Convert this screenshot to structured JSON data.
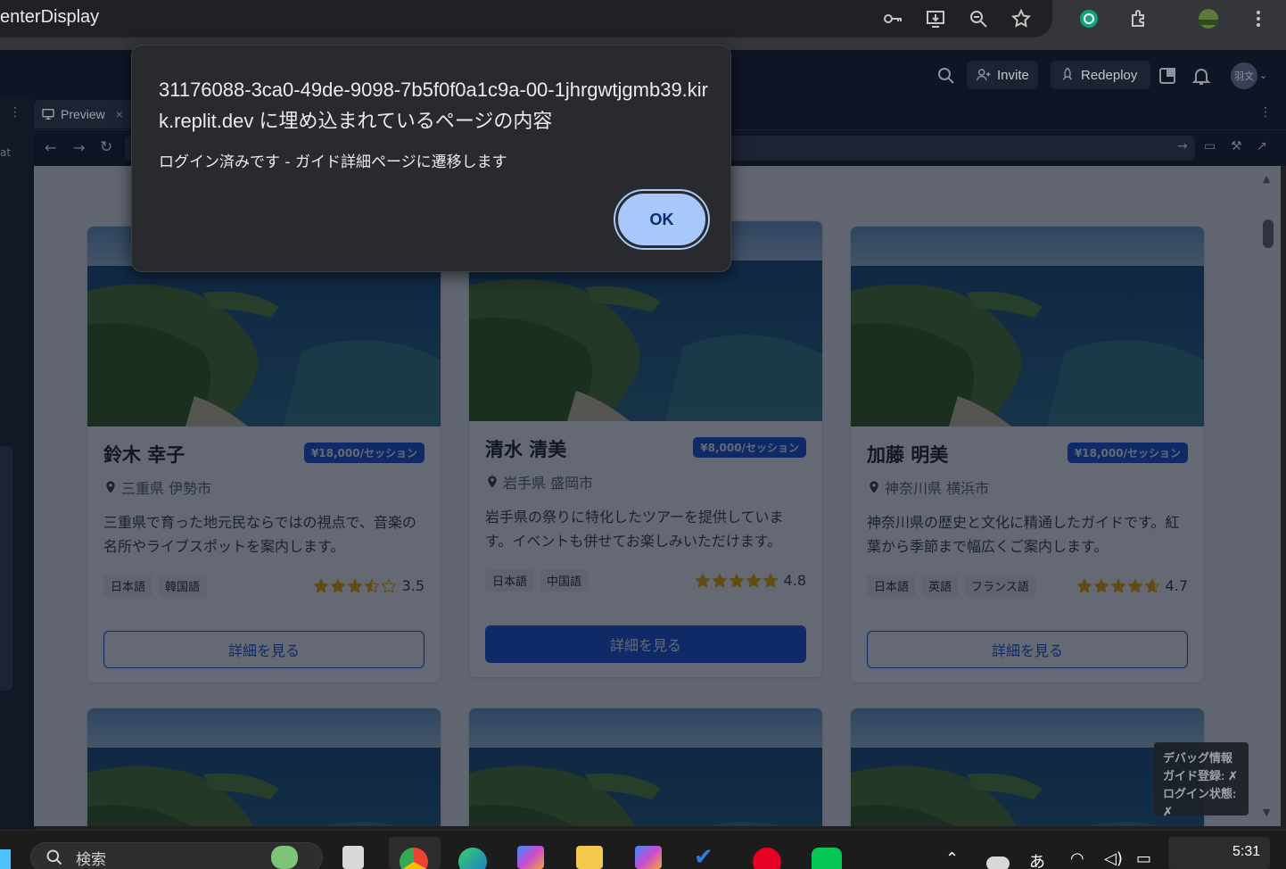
{
  "chrome": {
    "title": "enterDisplay"
  },
  "replit": {
    "invite_label": "Invite",
    "redeploy_label": "Redeploy",
    "preview_tab_label": "Preview",
    "avatar_text": "羽文",
    "left_fragment": "at"
  },
  "dialog": {
    "title": "31176088-3ca0-49de-9098-7b5f0f0a1c9a-00-1jhrgwtjgmb39.kirk.replit.dev に埋め込まれているページの内容",
    "message": "ログイン済みです - ガイド詳細ページに遷移します",
    "ok_label": "OK"
  },
  "guides": [
    {
      "name": "鈴木 幸子",
      "price": "¥18,000/セッション",
      "location": "三重県 伊勢市",
      "description": "三重県で育った地元民ならではの視点で、音楽の名所やライブスポットを案内します。",
      "languages": [
        "日本語",
        "韓国語"
      ],
      "rating": "3.5",
      "button": "詳細を見る"
    },
    {
      "name": "清水 清美",
      "price": "¥8,000/セッション",
      "location": "岩手県 盛岡市",
      "description": "岩手県の祭りに特化したツアーを提供しています。イベントも併せてお楽しみいただけます。",
      "languages": [
        "日本語",
        "中国語"
      ],
      "rating": "4.8",
      "button": "詳細を見る"
    },
    {
      "name": "加藤 明美",
      "price": "¥18,000/セッション",
      "location": "神奈川県 横浜市",
      "description": "神奈川県の歴史と文化に精通したガイドです。紅葉から季節まで幅広くご案内します。",
      "languages": [
        "日本語",
        "英語",
        "フランス語"
      ],
      "rating": "4.7",
      "button": "詳細を見る"
    }
  ],
  "debug": {
    "title": "デバッグ情報",
    "guide_registered": "ガイド登録: ✗",
    "login_state": "ログイン状態: ✗"
  },
  "taskbar": {
    "search_placeholder": "検索",
    "ime_label": "あ",
    "clock": "5:31"
  },
  "colors": {
    "accent": "#1a56db",
    "dialog_bg": "#292a2d",
    "ok_button": "#a8c7fa"
  }
}
